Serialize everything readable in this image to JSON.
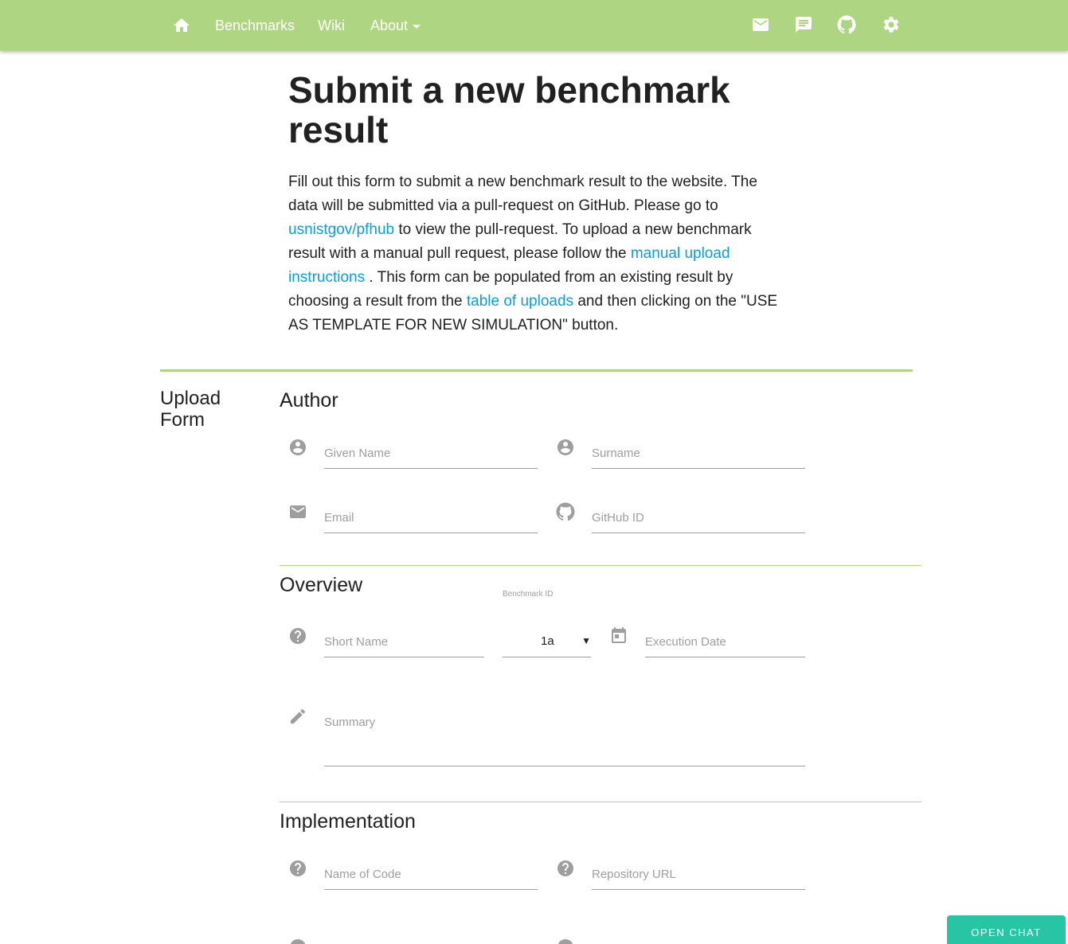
{
  "navbar": {
    "home_icon": "home-icon",
    "links": [
      "Benchmarks",
      "Wiki",
      "About"
    ],
    "icons": [
      "mail-icon",
      "chat-icon",
      "github-icon",
      "settings-icon"
    ],
    "background": "#aed581"
  },
  "intro": {
    "title": "Submit a new benchmark result",
    "p1": "Fill out this form to submit a new benchmark result to the website. The data will be submitted via a pull-request on GitHub. Please go to ",
    "link1": "usnistgov/pfhub",
    "p2": " to view the pull-request. To upload a new benchmark result with a manual pull request, please follow the ",
    "link2": "manual upload instructions",
    "p3": " . This form can be populated from an existing result by choosing a result from the ",
    "link3": "table of uploads",
    "p4": " and then clicking on the \"USE AS TEMPLATE FOR NEW SIMULATION\" button.",
    "link_color": "#0d9ddb"
  },
  "form": {
    "side_title": "Upload Form",
    "author": {
      "title": "Author",
      "given_name": "Given Name",
      "surname": "Surname",
      "email": "Email",
      "github_id": "GitHub ID"
    },
    "overview": {
      "title": "Overview",
      "short_name": "Short Name",
      "benchmark_label": "Benchmark ID",
      "benchmark_value": "1a",
      "execution_date": "Execution Date",
      "summary": "Summary"
    },
    "implementation": {
      "title": "Implementation",
      "name_of_code": "Name of Code",
      "repository_url": "Repository URL"
    }
  },
  "chat": {
    "label": "OPEN CHAT",
    "color": "#26c6a5"
  }
}
